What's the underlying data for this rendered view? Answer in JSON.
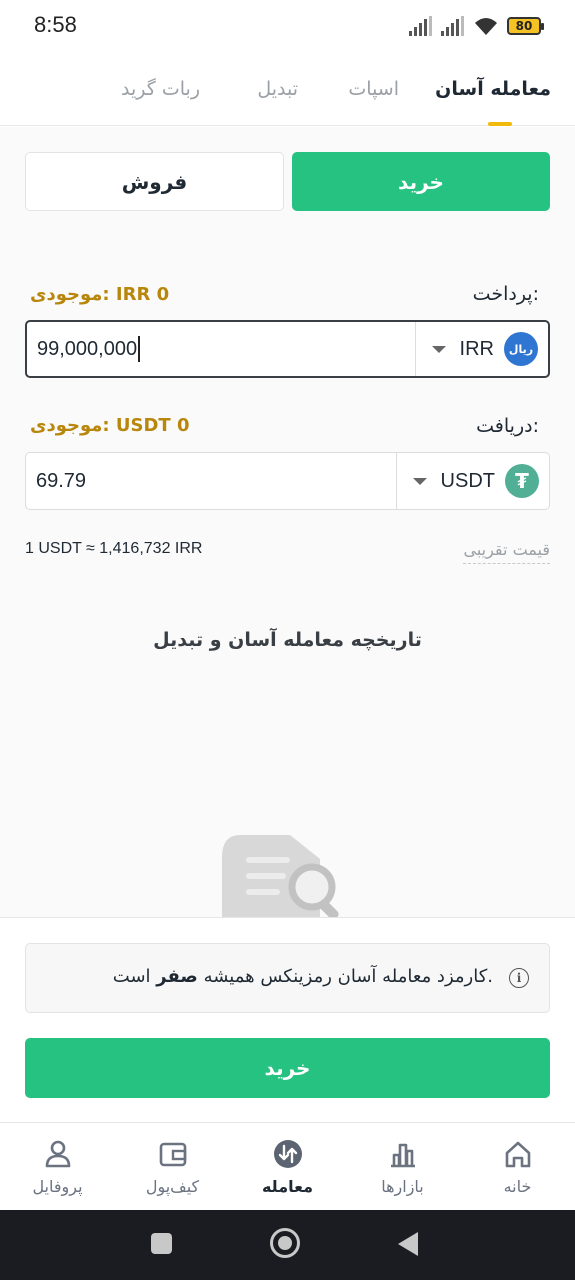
{
  "status": {
    "time": "8:58",
    "battery": "80"
  },
  "tabs": [
    {
      "label": "معامله آسان",
      "active": true
    },
    {
      "label": "اسپات",
      "active": false
    },
    {
      "label": "تبدیل",
      "active": false
    },
    {
      "label": "ربات گرید",
      "active": false
    }
  ],
  "toggle": {
    "buy": "خرید",
    "sell": "فروش"
  },
  "pay": {
    "label": "پرداخت:",
    "balance": "موجودی: IRR 0",
    "amount": "99,000,000",
    "currency": "IRR",
    "coin_badge": "ریال"
  },
  "receive": {
    "label": "دریافت:",
    "balance": "موجودی: USDT 0",
    "amount": "69.79",
    "currency": "USDT",
    "coin_badge": "₮"
  },
  "rate": {
    "label": "قیمت تقریبی",
    "value": "1 USDT ≈ 1,416,732 IRR"
  },
  "history_title": "تاریخچه معامله آسان و تبدیل",
  "notice": {
    "text_before": "کارمزد معامله آسان رمزینکس همیشه",
    "bold": "صفر",
    "text_after": "است."
  },
  "buy_button": "خرید",
  "bottom_nav": [
    {
      "label": "خانه",
      "icon": "home-icon"
    },
    {
      "label": "بازارها",
      "icon": "markets-icon"
    },
    {
      "label": "معامله",
      "icon": "trade-icon",
      "active": true
    },
    {
      "label": "کیف‌پول",
      "icon": "wallet-icon"
    },
    {
      "label": "پروفایل",
      "icon": "profile-icon"
    }
  ],
  "colors": {
    "accent_green": "#26c281",
    "balance_gold": "#b8860b",
    "tab_indicator": "#f0b90b",
    "usdt": "#50af95",
    "irr": "#2f76d3"
  }
}
